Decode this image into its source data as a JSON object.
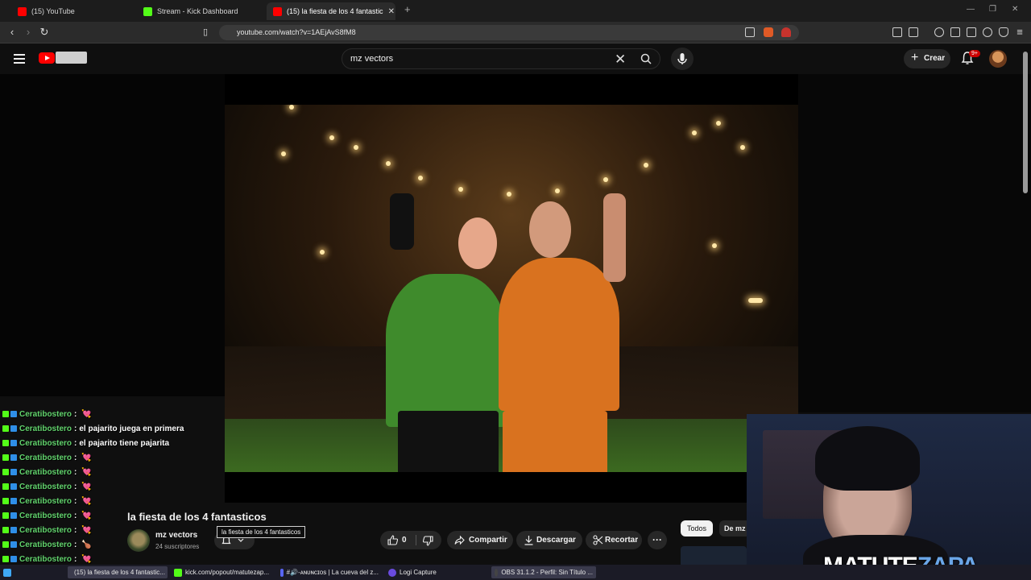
{
  "browser": {
    "tabs": [
      {
        "label": "(15) YouTube",
        "color": "#ff0000"
      },
      {
        "label": "Stream - Kick Dashboard",
        "color": "#53fc18"
      },
      {
        "label": "(15) la fiesta de los 4 fantastic",
        "color": "#ff0000",
        "active": true
      }
    ],
    "url": "youtube.com/watch?v=1AEjAvS8fM8"
  },
  "youtube": {
    "search_query": "mz vectors",
    "create_label": "Crear",
    "notifications_badge": "9+"
  },
  "chat": [
    {
      "user": "Ceratibostero",
      "msg": "",
      "heart": "💘"
    },
    {
      "user": "Ceratibostero",
      "msg": "el pajarito juega en primera",
      "heart": ""
    },
    {
      "user": "Ceratibostero",
      "msg": "el pajarito tiene pajarita",
      "heart": ""
    },
    {
      "user": "Ceratibostero",
      "msg": "",
      "heart": "💘"
    },
    {
      "user": "Ceratibostero",
      "msg": "",
      "heart": "💘"
    },
    {
      "user": "Ceratibostero",
      "msg": "",
      "heart": "💘"
    },
    {
      "user": "Ceratibostero",
      "msg": "",
      "heart": "💘"
    },
    {
      "user": "Ceratibostero",
      "msg": "",
      "heart": "💘"
    },
    {
      "user": "Ceratibostero",
      "msg": "",
      "heart": "💘"
    },
    {
      "user": "Ceratibostero",
      "msg": "",
      "heart": "🍗"
    },
    {
      "user": "Ceratibostero",
      "msg": "",
      "heart": "💘"
    }
  ],
  "video": {
    "title": "la fiesta de los 4 fantasticos",
    "channel": "mz vectors",
    "subscribers": "24 suscriptores",
    "tooltip": "la fiesta de los 4 fantasticos",
    "likes": "0",
    "share_label": "Compartir",
    "download_label": "Descargar",
    "clip_label": "Recortar",
    "more_label": "···"
  },
  "recommendations": {
    "chip_all": "Todos",
    "chip_from": "De mz"
  },
  "webcam": {
    "name_main": "MATUTE",
    "name_accent": "ZAPA"
  },
  "taskbar": [
    {
      "label": "(15) la fiesta de los 4 fantastic...",
      "color": "#ff0000"
    },
    {
      "label": "kick.com/popout/matutezap...",
      "color": "#53fc18"
    },
    {
      "label": "#🔊-ᴀɴᴜɴᴄɪᴏs | La cueva del z...",
      "color": "#5865f2"
    },
    {
      "label": "Logi Capture",
      "color": "#6a4be0"
    },
    {
      "label": "OBS 31.1.2 - Perfil: Sin Título ...",
      "color": "#444"
    }
  ]
}
